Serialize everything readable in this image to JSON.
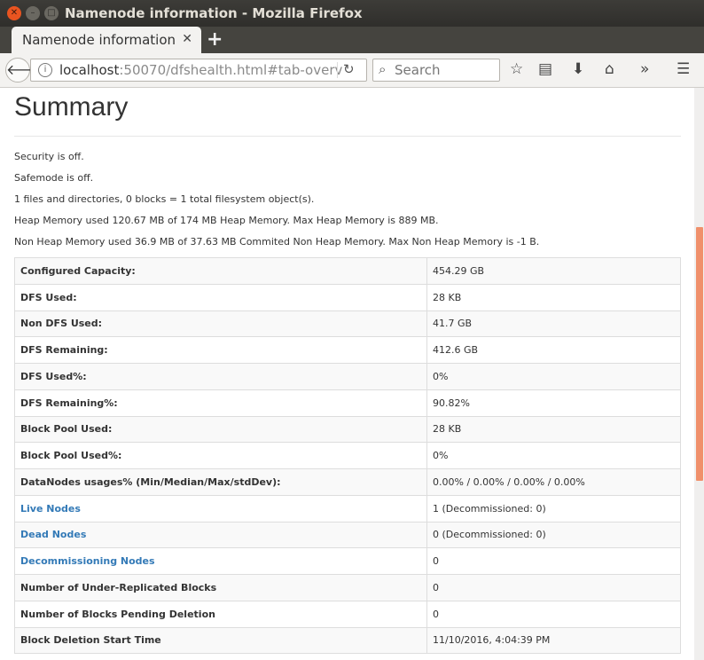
{
  "window": {
    "title": "Namenode information - Mozilla Firefox"
  },
  "tab": {
    "label": "Namenode information"
  },
  "nav": {
    "url_host": "localhost",
    "url_rest": ":50070/dfshealth.html#tab-overv",
    "search_placeholder": "Search"
  },
  "page": {
    "heading": "Summary",
    "lines": [
      "Security is off.",
      "Safemode is off.",
      "1 files and directories, 0 blocks = 1 total filesystem object(s).",
      "Heap Memory used 120.67 MB of 174 MB Heap Memory. Max Heap Memory is 889 MB.",
      "Non Heap Memory used 36.9 MB of 37.63 MB Commited Non Heap Memory. Max Non Heap Memory is -1 B."
    ],
    "rows": [
      {
        "key": "Configured Capacity:",
        "value": "454.29 GB"
      },
      {
        "key": "DFS Used:",
        "value": "28 KB"
      },
      {
        "key": "Non DFS Used:",
        "value": "41.7 GB"
      },
      {
        "key": "DFS Remaining:",
        "value": "412.6 GB"
      },
      {
        "key": "DFS Used%:",
        "value": "0%"
      },
      {
        "key": "DFS Remaining%:",
        "value": "90.82%"
      },
      {
        "key": "Block Pool Used:",
        "value": "28 KB"
      },
      {
        "key": "Block Pool Used%:",
        "value": "0%"
      },
      {
        "key": "DataNodes usages% (Min/Median/Max/stdDev):",
        "value": "0.00% / 0.00% / 0.00% / 0.00%"
      },
      {
        "key": "Live Nodes",
        "value": "1 (Decommissioned: 0)"
      },
      {
        "key": "Dead Nodes",
        "value": "0 (Decommissioned: 0)"
      },
      {
        "key": "Decommissioning Nodes",
        "value": "0"
      },
      {
        "key": "Number of Under-Replicated Blocks",
        "value": "0"
      },
      {
        "key": "Number of Blocks Pending Deletion",
        "value": "0"
      },
      {
        "key": "Block Deletion Start Time",
        "value": "11/10/2016, 4:04:39 PM"
      }
    ]
  }
}
